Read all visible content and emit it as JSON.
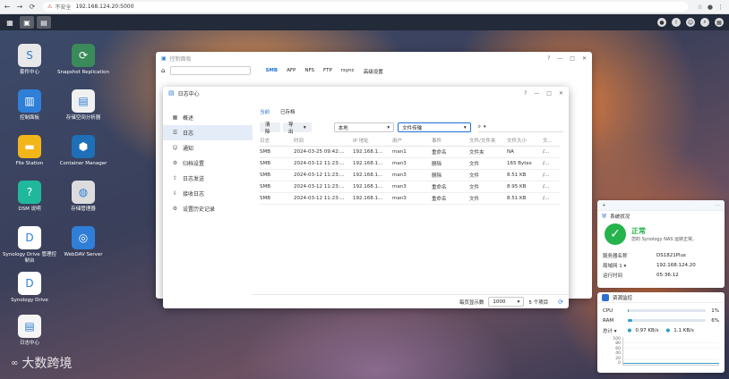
{
  "browser": {
    "back": "←",
    "forward": "→",
    "reload": "C",
    "insecure_label": "不安全",
    "url": "192.168.124.20:5000"
  },
  "desktop_apps": [
    {
      "label": "套件中心",
      "icon": "package-center-icon",
      "color": "#e8e8e8"
    },
    {
      "label": "Snapshot Replication",
      "icon": "snapshot-replication-icon",
      "color": "#3a8a5a"
    },
    {
      "label": "控制面板",
      "icon": "control-panel-icon",
      "color": "#2f7fd8"
    },
    {
      "label": "存储空间分析器",
      "icon": "storage-analyzer-icon",
      "color": "#f0f0f0"
    },
    {
      "label": "File Station",
      "icon": "folder-icon",
      "color": "#f2b51a"
    },
    {
      "label": "Container Manager",
      "icon": "container-manager-icon",
      "color": "#1e6fb8"
    },
    {
      "label": "DSM 说明",
      "icon": "help-icon",
      "color": "#1fb89c"
    },
    {
      "label": "存储管理器",
      "icon": "storage-manager-icon",
      "color": "#dcdcdc"
    },
    {
      "label": "Synology Drive 管理控制台",
      "icon": "drive-admin-icon",
      "color": "#ffffff"
    },
    {
      "label": "WebDAV Server",
      "icon": "webdav-icon",
      "color": "#2f7fd8"
    },
    {
      "label": "Synology Drive",
      "icon": "drive-icon",
      "color": "#ffffff"
    },
    {
      "label": "日志中心",
      "icon": "log-center-icon",
      "color": "#f5f5f5"
    }
  ],
  "control_panel": {
    "title": "控制面板",
    "tabs": [
      "SMB",
      "AFP",
      "NFS",
      "FTP",
      "rsync",
      "高级设置"
    ]
  },
  "log_center": {
    "title": "日志中心",
    "sidebar": [
      {
        "label": "概述",
        "icon": "overview-icon"
      },
      {
        "label": "日志",
        "icon": "log-icon"
      },
      {
        "label": "通知",
        "icon": "notification-icon"
      },
      {
        "label": "归档设置",
        "icon": "archive-icon"
      },
      {
        "label": "日志发送",
        "icon": "send-icon"
      },
      {
        "label": "接收日志",
        "icon": "receive-icon"
      },
      {
        "label": "设置历史记录",
        "icon": "history-icon"
      }
    ],
    "subtabs": [
      "当前",
      "已存档"
    ],
    "toolbar": {
      "clear": "清除",
      "export": "导出",
      "source": "本地",
      "log_type": "文件传输"
    },
    "columns": [
      "日志",
      "时间",
      "IP 地址",
      "用户",
      "事件",
      "文件/文件夹",
      "文件大小",
      "文..."
    ],
    "rows": [
      [
        "SMB",
        "2024-03-25 09:42:...",
        "192.168.1...",
        "man1",
        "重命名",
        "文件夹",
        "NA",
        "/..."
      ],
      [
        "SMB",
        "2024-03-12 11:23:...",
        "192.168.1...",
        "man3",
        "删除",
        "文件",
        "165 Bytes",
        "/..."
      ],
      [
        "SMB",
        "2024-03-12 11:23:...",
        "192.168.1...",
        "man3",
        "删除",
        "文件",
        "8.51 KB",
        "/..."
      ],
      [
        "SMB",
        "2024-03-12 11:23:...",
        "192.168.1...",
        "man3",
        "重命名",
        "文件",
        "8.95 KB",
        "/..."
      ],
      [
        "SMB",
        "2024-03-12 11:23:...",
        "192.168.1...",
        "man3",
        "重命名",
        "文件",
        "8.51 KB",
        "/..."
      ]
    ],
    "footer": {
      "per_page_label": "每页显示数",
      "per_page": "1000",
      "count": "5 个项目"
    }
  },
  "system_health": {
    "title": "系统状况",
    "status": "正常",
    "status_desc": "您的 Synology NAS 运转正常。",
    "server_name_label": "服务器名称",
    "server_name": "DS1821Plus",
    "lan_label": "局域网 1",
    "lan_ip": "192.168.124.20",
    "uptime_label": "运行时间",
    "uptime": "05:36:12"
  },
  "resource_monitor": {
    "title": "资源监控",
    "cpu_label": "CPU",
    "cpu_value": "1%",
    "cpu_fraction": 0.01,
    "ram_label": "RAM",
    "ram_value": "6%",
    "ram_fraction": 0.06,
    "total_label": "总计",
    "up": "0.97 KB/s",
    "down": "1.1 KB/s",
    "y_ticks": [
      "100",
      "80",
      "60",
      "40",
      "20",
      "0"
    ]
  },
  "watermark": "大数跨境"
}
